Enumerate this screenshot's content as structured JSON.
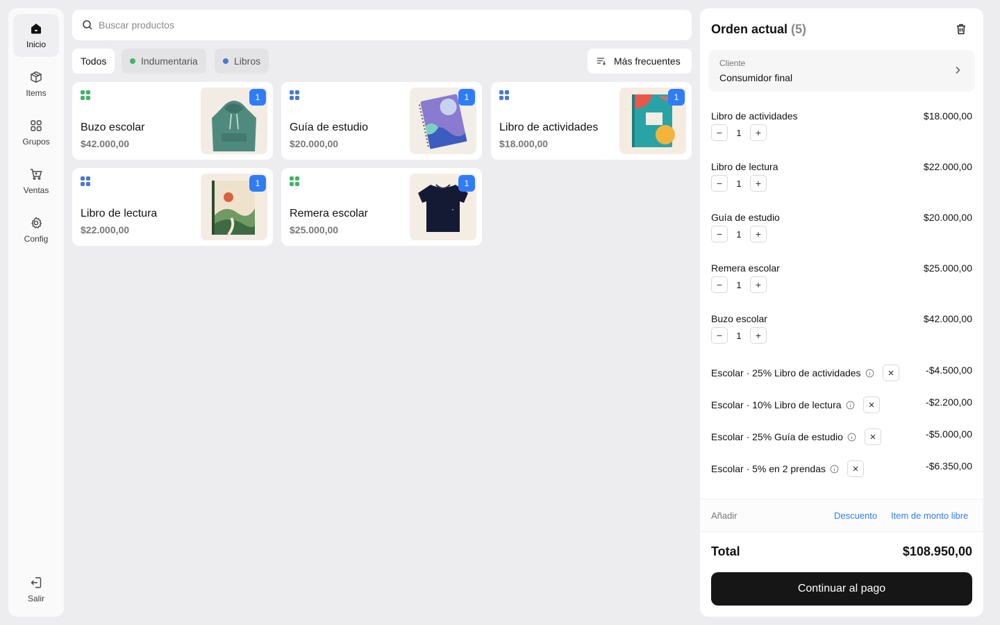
{
  "nav": {
    "items": [
      {
        "label": "Inicio",
        "icon": "home-icon"
      },
      {
        "label": "Items",
        "icon": "box-icon"
      },
      {
        "label": "Grupos",
        "icon": "grid-icon"
      },
      {
        "label": "Ventas",
        "icon": "cart-icon"
      },
      {
        "label": "Config",
        "icon": "gear-icon"
      }
    ],
    "logout": "Salir"
  },
  "search": {
    "placeholder": "Buscar productos",
    "value": ""
  },
  "filters": {
    "all": "Todos",
    "clothing": "Indumentaria",
    "books": "Libros",
    "sort": "Más frecuentes"
  },
  "colors": {
    "clothing": "#3fb567",
    "books": "#4a78d2",
    "accent": "#2f7df6"
  },
  "products": [
    {
      "name": "Buzo escolar",
      "price": "$42.000,00",
      "qty": "1",
      "category": "clothing"
    },
    {
      "name": "Guía de estudio",
      "price": "$20.000,00",
      "qty": "1",
      "category": "books"
    },
    {
      "name": "Libro de actividades",
      "price": "$18.000,00",
      "qty": "1",
      "category": "books"
    },
    {
      "name": "Libro de lectura",
      "price": "$22.000,00",
      "qty": "1",
      "category": "books"
    },
    {
      "name": "Remera escolar",
      "price": "$25.000,00",
      "qty": "1",
      "category": "clothing"
    }
  ],
  "order": {
    "title": "Orden actual",
    "count": "(5)",
    "customer_label": "Cliente",
    "customer_value": "Consumidor final",
    "lines": [
      {
        "name": "Libro de actividades",
        "price": "$18.000,00",
        "qty": "1"
      },
      {
        "name": "Libro de lectura",
        "price": "$22.000,00",
        "qty": "1"
      },
      {
        "name": "Guía de estudio",
        "price": "$20.000,00",
        "qty": "1"
      },
      {
        "name": "Remera escolar",
        "price": "$25.000,00",
        "qty": "1"
      },
      {
        "name": "Buzo escolar",
        "price": "$42.000,00",
        "qty": "1"
      }
    ],
    "discounts": [
      {
        "label": "Escolar · 25% Libro de actividades",
        "amount": "-$4.500,00"
      },
      {
        "label": "Escolar · 10% Libro de lectura",
        "amount": "-$2.200,00"
      },
      {
        "label": "Escolar · 25% Guía de estudio",
        "amount": "-$5.000,00"
      },
      {
        "label": "Escolar · 5% en 2 prendas",
        "amount": "-$6.350,00"
      }
    ],
    "add_label": "Añadir",
    "add_discount": "Descuento",
    "add_free_item": "Item de monto libre",
    "total_label": "Total",
    "total_value": "$108.950,00",
    "pay_label": "Continuar al pago"
  }
}
